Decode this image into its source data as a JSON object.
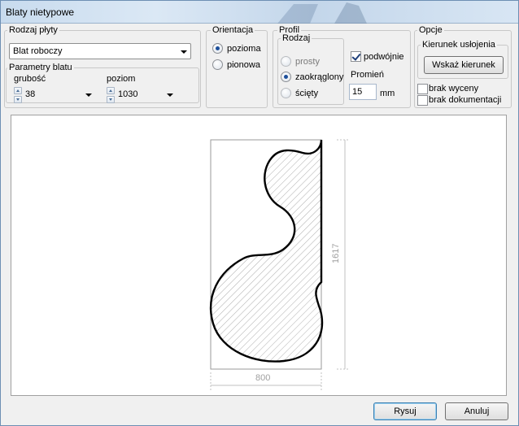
{
  "window": {
    "title": "Blaty nietypowe"
  },
  "rodzaj_plyty": {
    "label": "Rodzaj płyty",
    "value": "Blat roboczy"
  },
  "parametry": {
    "label": "Parametry blatu",
    "grubosc_label": "grubość",
    "grubosc_value": "38",
    "poziom_label": "poziom",
    "poziom_value": "1030"
  },
  "orientacja": {
    "label": "Orientacja",
    "options": [
      "pozioma",
      "pionowa"
    ],
    "selected": "pozioma"
  },
  "profil": {
    "label": "Profil",
    "rodzaj_label": "Rodzaj",
    "options": [
      "prosty",
      "zaokrąglony",
      "ścięty"
    ],
    "selected": "zaokrąglony",
    "podwojnie_label": "podwójnie",
    "podwojnie_checked": true,
    "promien_label": "Promień",
    "promien_value": "15",
    "unit": "mm"
  },
  "opcje": {
    "label": "Opcje",
    "kierunek_label": "Kierunek usłojenia",
    "kierunek_button": "Wskaż kierunek",
    "brak_wyceny": "brak wyceny",
    "brak_dokumentacji": "brak dokumentacji"
  },
  "drawing": {
    "width_dim": "800",
    "height_dim": "1617"
  },
  "buttons": {
    "rysuj": "Rysuj",
    "anuluj": "Anuluj"
  }
}
